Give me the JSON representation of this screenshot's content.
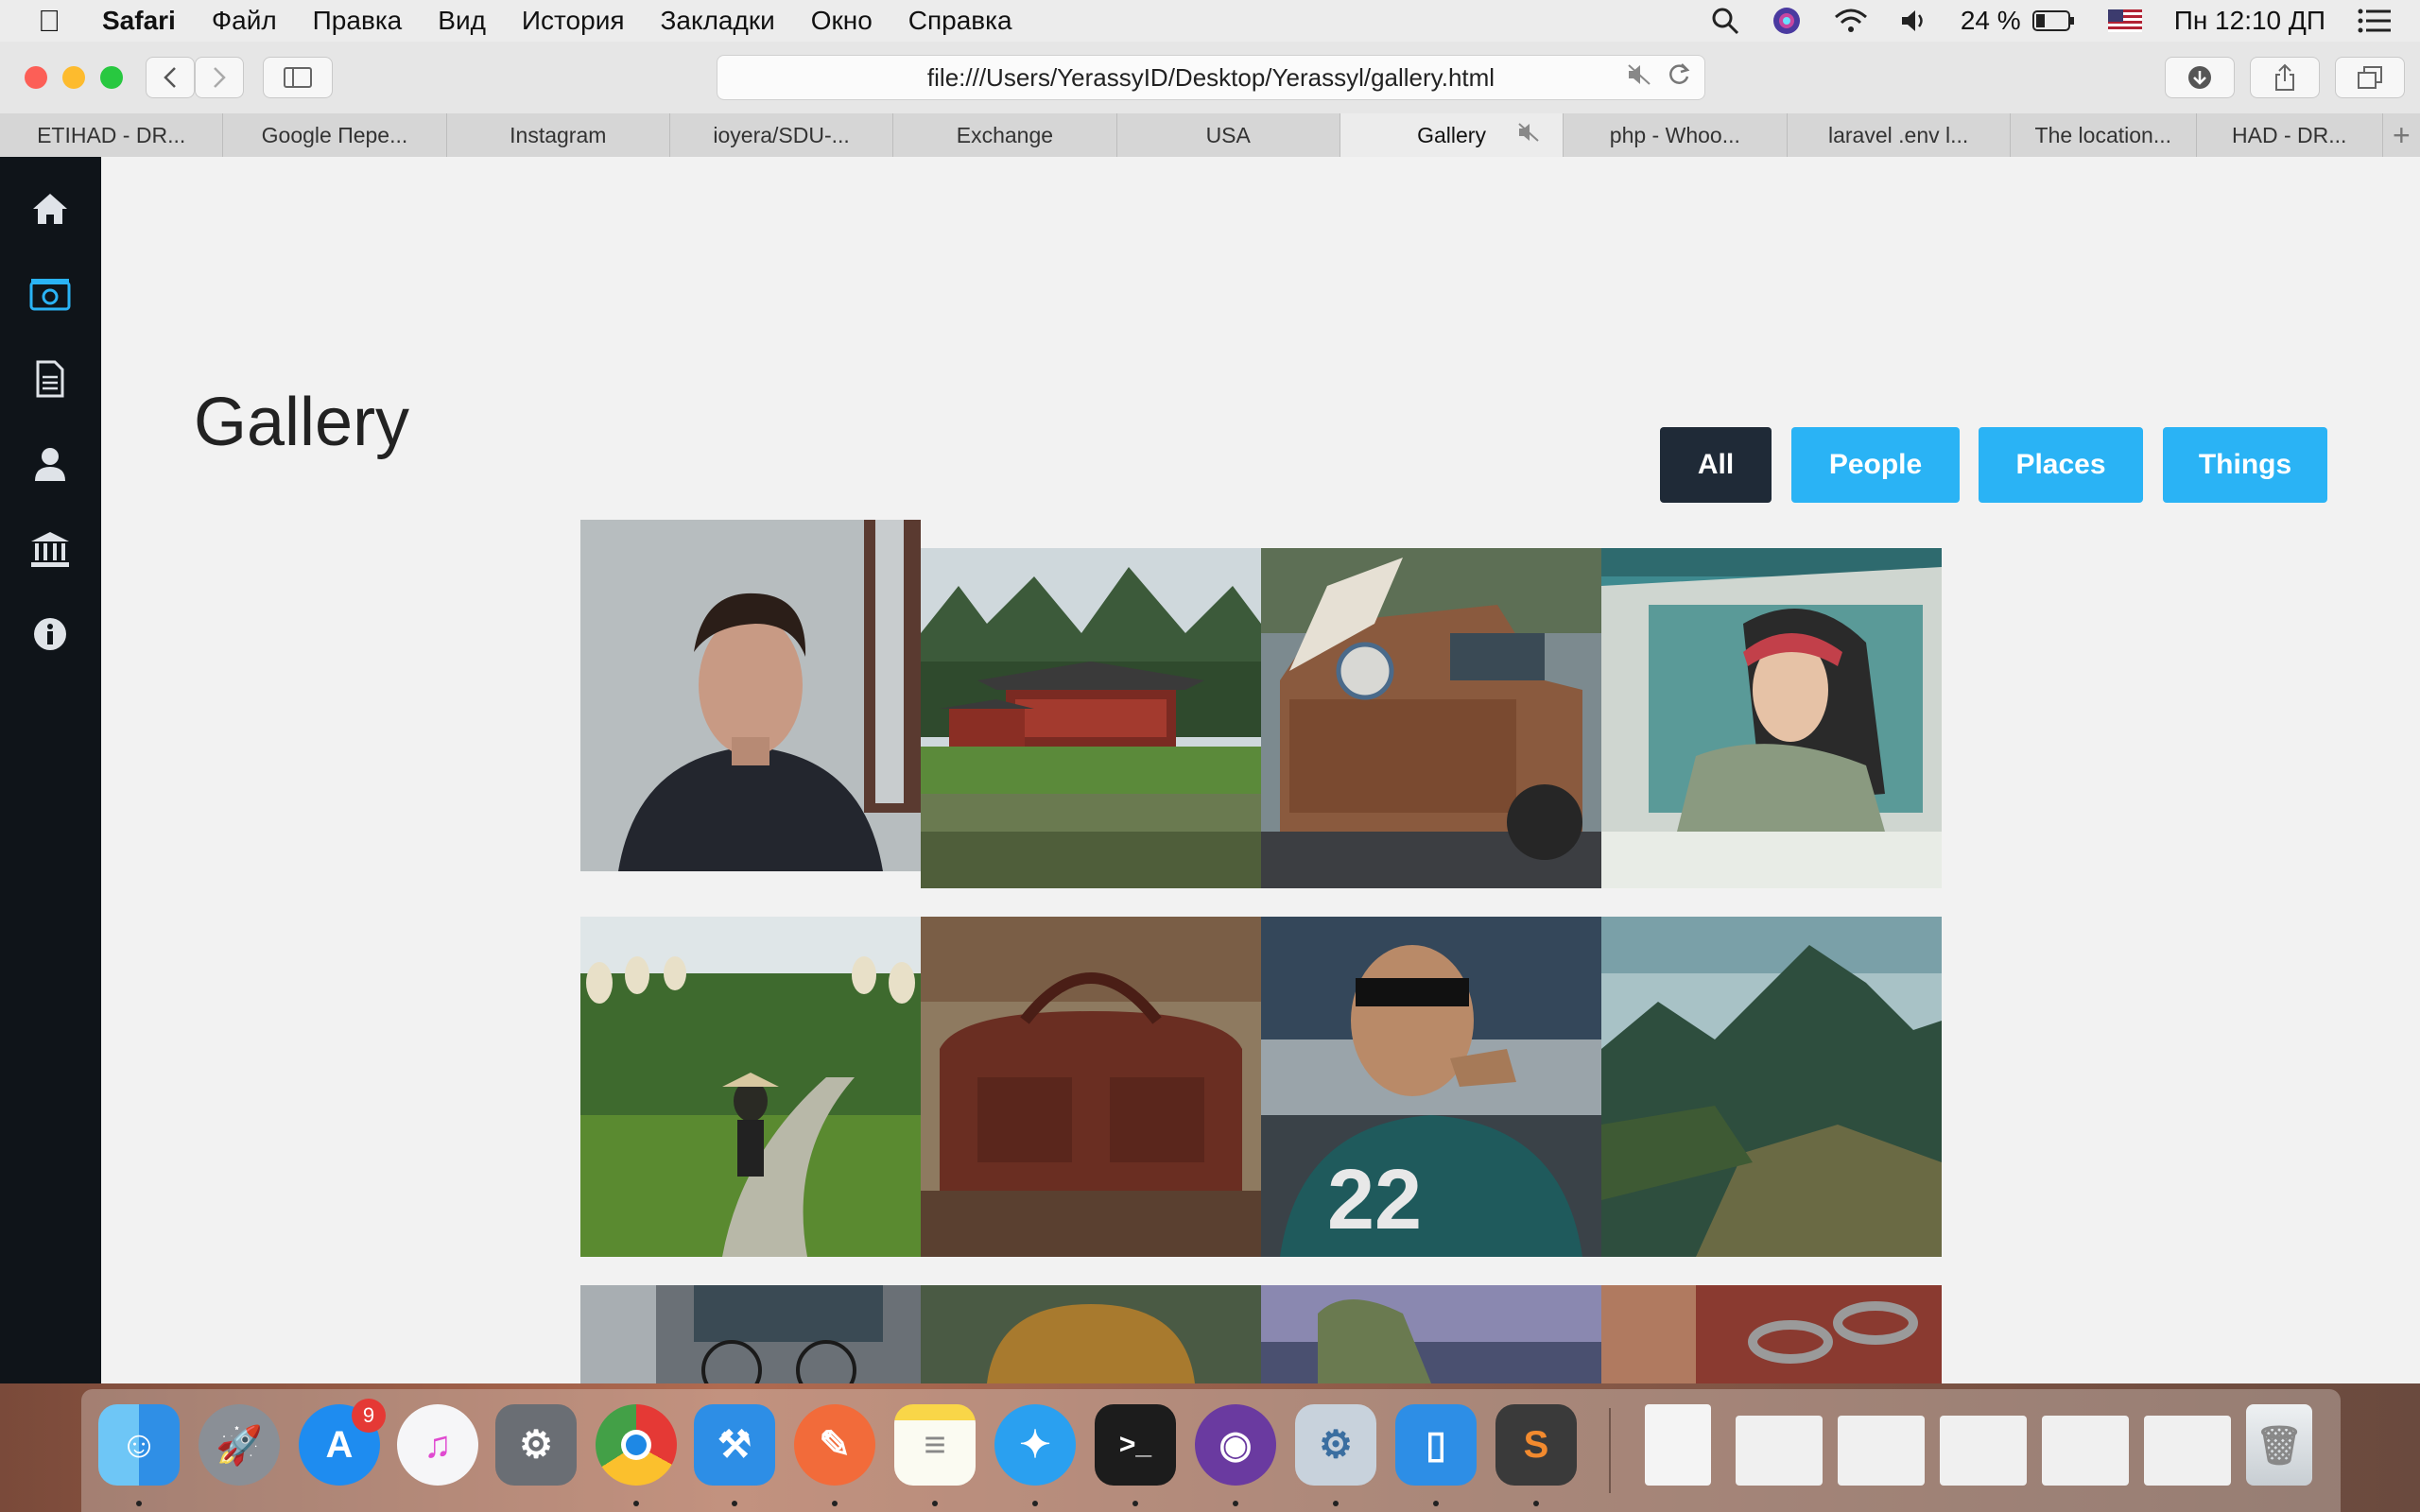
{
  "menubar": {
    "app_name": "Safari",
    "items": [
      "Файл",
      "Правка",
      "Вид",
      "История",
      "Закладки",
      "Окно",
      "Справка"
    ],
    "battery": "24 %",
    "clock": "Пн 12:10 ДП"
  },
  "browser": {
    "url": "file:///Users/YerassyID/Desktop/Yerassyl/gallery.html",
    "tabs": [
      {
        "label": "ETIHAD - DR..."
      },
      {
        "label": "Google Пере..."
      },
      {
        "label": "Instagram"
      },
      {
        "label": "ioyera/SDU-..."
      },
      {
        "label": "Exchange"
      },
      {
        "label": "USA"
      },
      {
        "label": "Gallery"
      },
      {
        "label": "php - Whoo..."
      },
      {
        "label": "laravel .env l..."
      },
      {
        "label": "The location..."
      },
      {
        "label": "HAD - DR..."
      }
    ],
    "active_tab": "Gallery"
  },
  "sidebar": {
    "icons": [
      "home-icon",
      "gallery-icon",
      "document-icon",
      "user-icon",
      "bank-icon",
      "info-icon"
    ],
    "active": "gallery-icon",
    "active_color": "#2ab3f5"
  },
  "page": {
    "title": "Gallery",
    "filters": [
      {
        "label": "All",
        "active": true
      },
      {
        "label": "People",
        "active": false
      },
      {
        "label": "Places",
        "active": false
      },
      {
        "label": "Things",
        "active": false
      }
    ],
    "colors": {
      "active_filter": "#1f2a37",
      "filter": "#2ab3f5"
    }
  },
  "dock": {
    "appstore_badge": "9"
  }
}
